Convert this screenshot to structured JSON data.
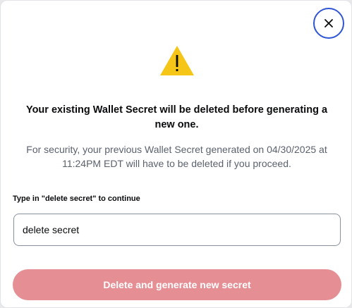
{
  "dialog": {
    "title": "Your existing Wallet Secret will be deleted before generating a new one.",
    "description": "For security, your previous Wallet Secret generated on 04/30/2025 at 11:24PM EDT will have to be deleted if you proceed.",
    "confirm_label": "Type in \"delete secret\" to continue",
    "confirm_value": "delete secret",
    "submit_label": "Delete and generate new secret",
    "close_icon": "close-icon",
    "warning_icon": "warning-icon"
  },
  "colors": {
    "warning": "#f5c518",
    "close_ring": "#2f55d4",
    "submit_disabled": "#e58f94",
    "title_text": "#0a0b0d",
    "muted_text": "#5b616e"
  }
}
